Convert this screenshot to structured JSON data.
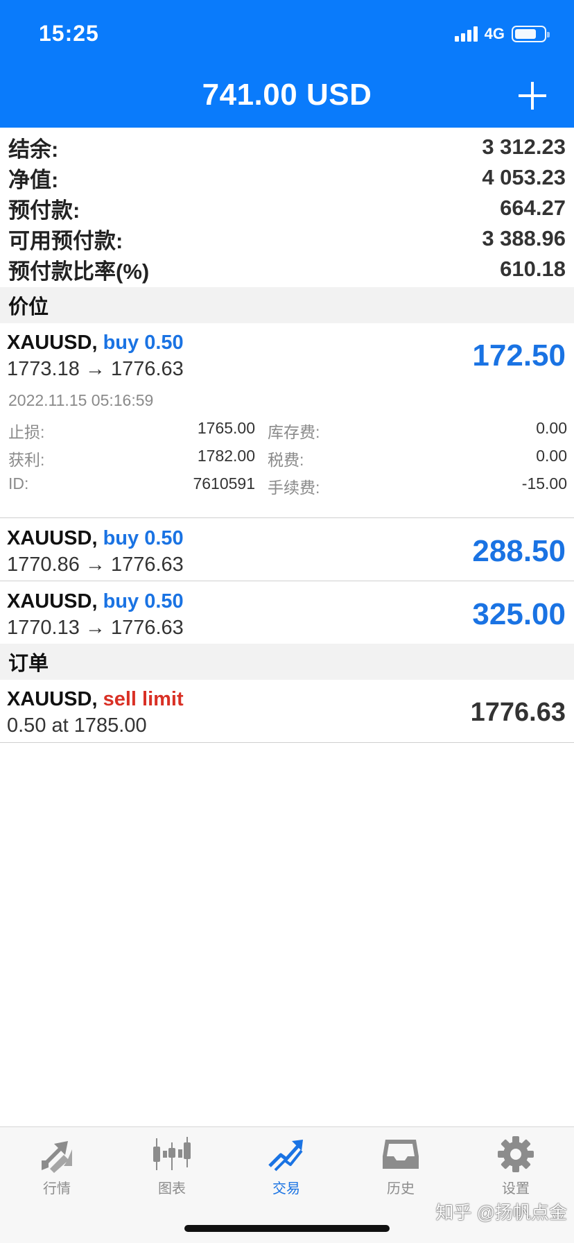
{
  "status": {
    "time": "15:25",
    "network": "4G",
    "battery_level": 0.75
  },
  "header": {
    "title": "741.00 USD"
  },
  "summary": [
    {
      "label": "结余:",
      "value": "3 312.23"
    },
    {
      "label": "净值:",
      "value": "4 053.23"
    },
    {
      "label": "预付款:",
      "value": "664.27"
    },
    {
      "label": "可用预付款:",
      "value": "3 388.96"
    },
    {
      "label": "预付款比率(%)",
      "value": "610.18"
    }
  ],
  "positions_section": {
    "title": "价位"
  },
  "positions": [
    {
      "symbol": "XAUUSD,",
      "side": "buy 0.50",
      "prices": "1773.18 → 1776.63",
      "profit": "172.50",
      "details": {
        "time": "2022.11.15 05:16:59",
        "rows": [
          {
            "l1": "止损:",
            "v1": "1765.00",
            "l2": "库存费:",
            "v2": "0.00"
          },
          {
            "l1": "获利:",
            "v1": "1782.00",
            "l2": "税费:",
            "v2": "0.00"
          },
          {
            "l1": "ID:",
            "v1": "7610591",
            "l2": "手续费:",
            "v2": "-15.00"
          }
        ]
      }
    },
    {
      "symbol": "XAUUSD,",
      "side": "buy 0.50",
      "prices": "1770.86 → 1776.63",
      "profit": "288.50"
    },
    {
      "symbol": "XAUUSD,",
      "side": "buy 0.50",
      "prices": "1770.13 → 1776.63",
      "profit": "325.00"
    }
  ],
  "orders_section": {
    "title": "订单"
  },
  "orders": [
    {
      "symbol": "XAUUSD,",
      "side": "sell limit",
      "detail": "0.50 at 1785.00",
      "price": "1776.63"
    }
  ],
  "tabs": [
    {
      "label": "行情",
      "icon": "quotes-arrows-icon",
      "active": false
    },
    {
      "label": "图表",
      "icon": "candlestick-chart-icon",
      "active": false
    },
    {
      "label": "交易",
      "icon": "trade-trend-icon",
      "active": true
    },
    {
      "label": "历史",
      "icon": "history-inbox-icon",
      "active": false
    },
    {
      "label": "设置",
      "icon": "settings-gear-icon",
      "active": false
    }
  ],
  "watermark": "知乎 @扬帆点金",
  "colors": {
    "header": "#0a7bfb",
    "buy": "#1a73e3",
    "sell": "#d93025",
    "section_bg": "#f2f2f2"
  }
}
